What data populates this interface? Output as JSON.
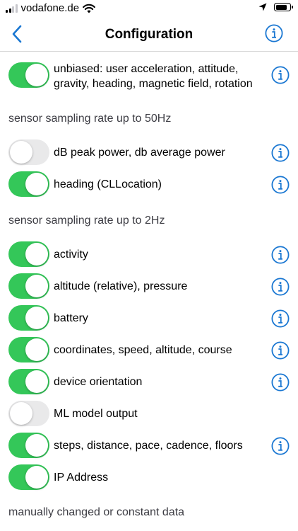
{
  "status_bar": {
    "carrier": "vodafone.de"
  },
  "nav": {
    "title": "Configuration"
  },
  "rows": [
    {
      "id": "unbiased",
      "lines": [
        "unbiased: user acceleration, attitude,",
        "gravity, heading, magnetic field, rotation"
      ],
      "on": true,
      "info": true
    },
    {
      "id": "db-power",
      "label": "dB peak power, db average power",
      "on": false,
      "info": true
    },
    {
      "id": "heading",
      "label": "heading (CLLocation)",
      "on": true,
      "info": true
    },
    {
      "id": "activity",
      "label": "activity",
      "on": true,
      "info": true
    },
    {
      "id": "altitude",
      "label": "altitude (relative), pressure",
      "on": true,
      "info": true
    },
    {
      "id": "battery",
      "label": "battery",
      "on": true,
      "info": true
    },
    {
      "id": "coordinates",
      "label": "coordinates, speed, altitude, course",
      "on": true,
      "info": true
    },
    {
      "id": "device-orientation",
      "label": "device orientation",
      "on": true,
      "info": true
    },
    {
      "id": "ml-model",
      "label": "ML model output",
      "on": false,
      "info": false
    },
    {
      "id": "steps",
      "label": "steps, distance, pace, cadence, floors",
      "on": true,
      "info": true
    },
    {
      "id": "ip-address",
      "label": "IP Address",
      "on": true,
      "info": false
    }
  ],
  "sections": {
    "s50": "sensor sampling rate up to 50Hz",
    "s2": "sensor sampling rate up to 2Hz",
    "manual": "manually changed or constant data"
  },
  "colors": {
    "accent": "#1a77d2",
    "toggle_on": "#34c759",
    "toggle_off": "#e9e9ea"
  }
}
